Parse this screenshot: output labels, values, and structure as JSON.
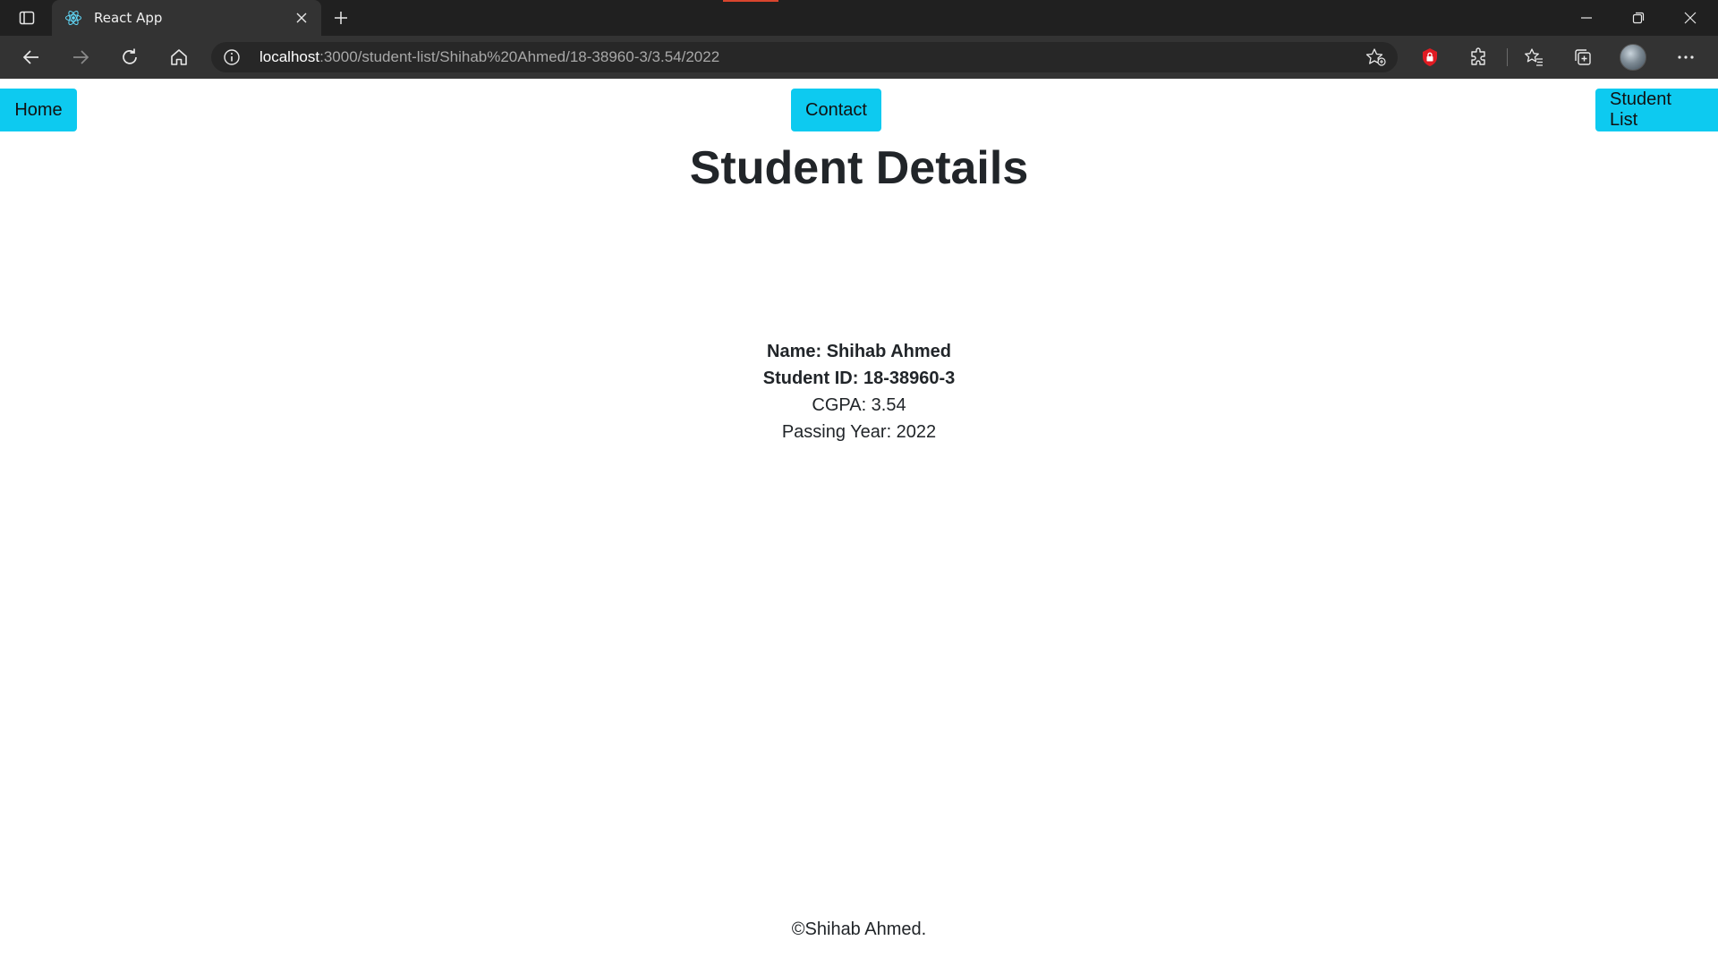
{
  "browser": {
    "tab_title": "React App",
    "url_host": "localhost",
    "url_path": ":3000/student-list/Shihab%20Ahmed/18-38960-3/3.54/2022",
    "icons": {
      "tab_actions": "tab-actions-icon",
      "favicon": "react-logo-icon",
      "tab_close": "close-icon",
      "new_tab": "plus-icon",
      "back": "arrow-left-icon",
      "forward": "arrow-right-icon",
      "refresh": "refresh-icon",
      "home": "home-icon",
      "site_info": "info-icon",
      "add_favorite": "star-plus-icon",
      "extension_lock": "lock-extension-icon",
      "extensions": "puzzle-icon",
      "favorites": "favorites-icon",
      "collections": "collections-icon",
      "more": "more-icon"
    },
    "colors": {
      "chrome_bg": "#202020",
      "toolbar_bg": "#333333",
      "accent_record": "#d9452e"
    }
  },
  "nav": {
    "home_label": "Home",
    "contact_label": "Contact",
    "student_list_label": "Student List",
    "button_color": "#0dcaf0"
  },
  "page": {
    "title": "Student Details",
    "name_line": "Name: Shihab Ahmed",
    "id_line": "Student ID: 18-38960-3",
    "cgpa_line": "CGPA: 3.54",
    "year_line": "Passing Year: 2022",
    "footer": "©Shihab Ahmed."
  }
}
